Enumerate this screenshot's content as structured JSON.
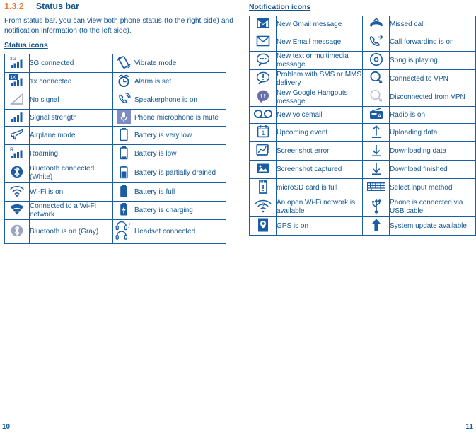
{
  "left": {
    "section_number": "1.3.2",
    "section_title": "Status bar",
    "intro": "From status bar, you can view both phone status (to the right side) and notification information (to the left side).",
    "subhead": "Status icons",
    "page_number": "10",
    "rows": [
      {
        "icon_a": "3g-signal-icon",
        "label_a": "3G connected",
        "icon_b": "vibrate-icon",
        "label_b": "Vibrate mode"
      },
      {
        "icon_a": "1x-signal-icon",
        "label_a": "1x connected",
        "icon_b": "alarm-clock-icon",
        "label_b": "Alarm is set"
      },
      {
        "icon_a": "no-signal-icon",
        "label_a": "No signal",
        "icon_b": "speakerphone-icon",
        "label_b": "Speakerphone is on"
      },
      {
        "icon_a": "signal-strength-icon",
        "label_a": "Signal strength",
        "icon_b": "microphone-mute-icon",
        "label_b": "Phone microphone is mute"
      },
      {
        "icon_a": "airplane-icon",
        "label_a": "Airplane mode",
        "icon_b": "battery-very-low-icon",
        "label_b": "Battery is very low"
      },
      {
        "icon_a": "roaming-icon",
        "label_a": "Roaming",
        "icon_b": "battery-low-icon",
        "label_b": "Battery is low"
      },
      {
        "icon_a": "bluetooth-connected-icon",
        "label_a": "Bluetooth connected (White)",
        "icon_b": "battery-partial-icon",
        "label_b": "Battery is partially drained"
      },
      {
        "icon_a": "wifi-on-icon",
        "label_a": "Wi-Fi is on",
        "icon_b": "battery-full-icon",
        "label_b": "Battery is full"
      },
      {
        "icon_a": "wifi-connected-icon",
        "label_a": "Connected to a Wi-Fi network",
        "icon_b": "battery-charging-icon",
        "label_b": "Battery is charging"
      },
      {
        "icon_a": "bluetooth-on-gray-icon",
        "label_a": "Bluetooth is on (Gray)",
        "icon_b": "headset-icon",
        "label_b": "Headset connected"
      }
    ]
  },
  "right": {
    "subhead": "Notification icons",
    "page_number": "11",
    "rows": [
      {
        "icon_a": "gmail-icon",
        "label_a": "New Gmail message",
        "icon_b": "missed-call-icon",
        "label_b": "Missed call"
      },
      {
        "icon_a": "email-icon",
        "label_a": "New Email message",
        "icon_b": "call-forwarding-icon",
        "label_b": "Call forwarding is on"
      },
      {
        "icon_a": "sms-message-icon",
        "label_a": "New text or multimedia message",
        "icon_b": "music-playing-icon",
        "label_b": "Song is playing"
      },
      {
        "icon_a": "sms-problem-icon",
        "label_a": "Problem with SMS or MMS delivery",
        "icon_b": "vpn-connected-icon",
        "label_b": "Connected to VPN"
      },
      {
        "icon_a": "hangouts-icon",
        "label_a": "New Google Hangouts message",
        "icon_b": "vpn-disconnected-icon",
        "label_b": "Disconnected from VPN"
      },
      {
        "icon_a": "voicemail-icon",
        "label_a": "New voicemail",
        "icon_b": "radio-icon",
        "label_b": "Radio is on"
      },
      {
        "icon_a": "calendar-event-icon",
        "label_a": "Upcoming event",
        "icon_b": "upload-icon",
        "label_b": "Uploading data"
      },
      {
        "icon_a": "screenshot-error-icon",
        "label_a": "Screenshot error",
        "icon_b": "download-icon",
        "label_b": "Downloading data"
      },
      {
        "icon_a": "screenshot-captured-icon",
        "label_a": " Screenshot captured",
        "icon_b": "download-finished-icon",
        "label_b": "Download finished"
      },
      {
        "icon_a": "sdcard-full-icon",
        "label_a": "microSD card is full",
        "icon_b": "keyboard-icon",
        "label_b": "Select input method"
      },
      {
        "icon_a": "open-wifi-icon",
        "label_a": "An open Wi-Fi network is available",
        "icon_b": "usb-icon",
        "label_b": "Phone is connected via USB cable"
      },
      {
        "icon_a": "gps-icon",
        "label_a": "GPS is on",
        "icon_b": "system-update-icon",
        "label_b": "System update available"
      }
    ]
  },
  "colors": {
    "accent_orange": "#E8762C",
    "brand_blue": "#14558F",
    "table_border": "#1B5DA3",
    "gray_icon": "#9AA4BF"
  }
}
